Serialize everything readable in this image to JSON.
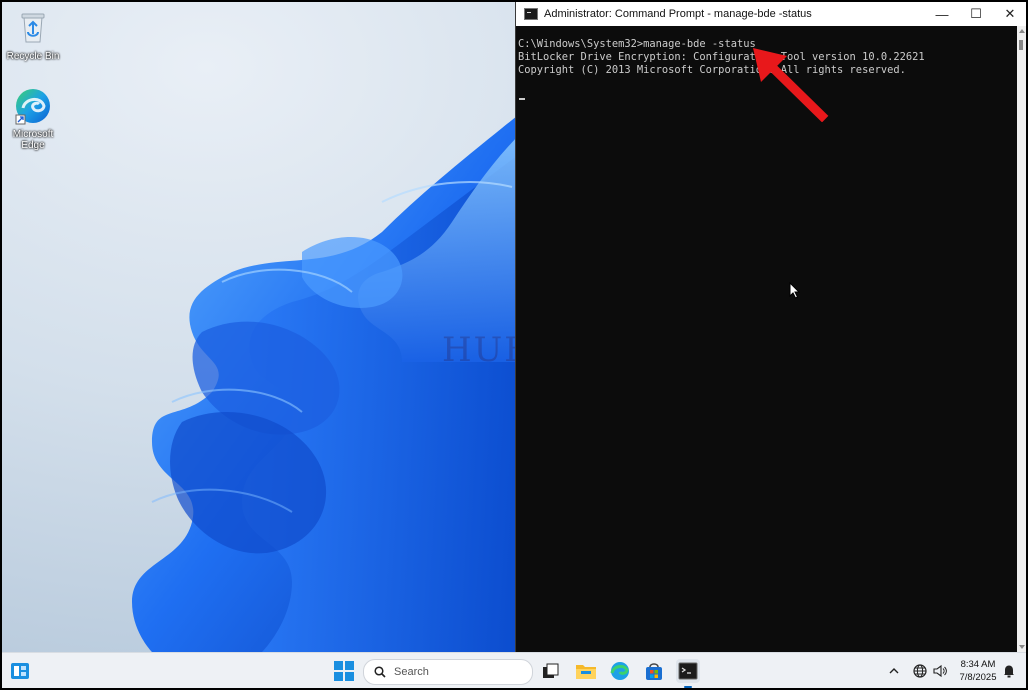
{
  "desktop": {
    "icons": [
      {
        "label": "Recycle Bin",
        "icon": "recycle-bin-icon"
      },
      {
        "label": "Microsoft Edge",
        "icon": "edge-icon"
      }
    ],
    "watermark": "HUB"
  },
  "cmd_window": {
    "title": "Administrator: Command Prompt - manage-bde  -status",
    "controls": {
      "minimize": "—",
      "maximize": "☐",
      "close": "✕"
    },
    "lines": [
      "C:\\Windows\\System32>manage-bde -status",
      "BitLocker Drive Encryption: Configuration Tool version 10.0.22621",
      "Copyright (C) 2013 Microsoft Corporation. All rights reserved."
    ]
  },
  "annotation": {
    "arrow_color": "#e8181b"
  },
  "taskbar": {
    "search_placeholder": "Search",
    "apps": [
      "widgets-icon",
      "start-icon",
      "task-view-icon",
      "file-explorer-icon",
      "edge-icon",
      "store-icon",
      "terminal-icon"
    ],
    "tray": {
      "chevron": "^",
      "time": "8:34 AM",
      "date": "7/8/2025"
    }
  },
  "colors": {
    "accent": "#005fb8",
    "console_bg": "#0c0c0c",
    "console_text": "#cccccc",
    "bloom_blue": "#1a6cf0"
  }
}
